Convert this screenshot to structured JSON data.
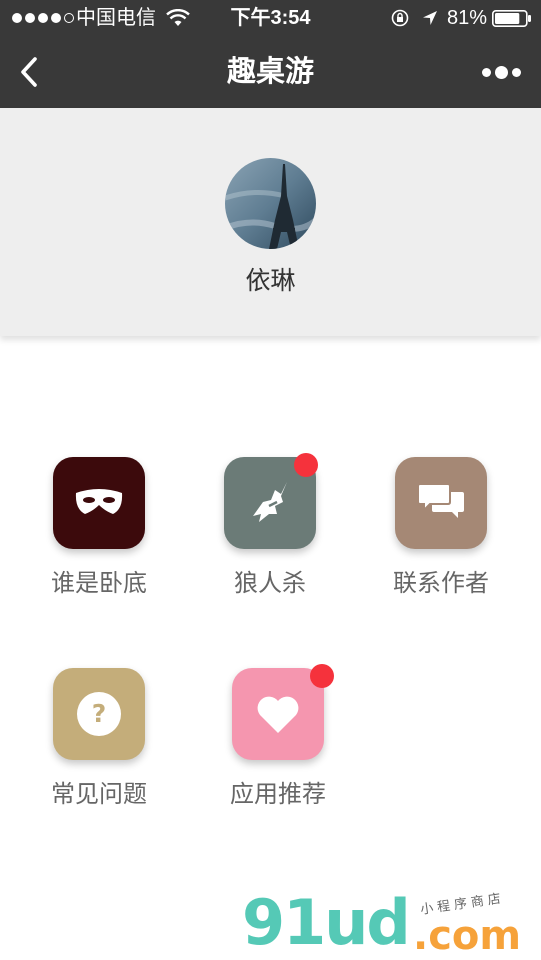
{
  "status_bar": {
    "carrier": "中国电信",
    "time": "下午3:54",
    "battery_pct": "81%",
    "battery_level": 0.81,
    "signal_bars": 4,
    "signal_max": 5
  },
  "nav": {
    "title": "趣桌游"
  },
  "profile": {
    "username": "依琳"
  },
  "grid": [
    {
      "label": "谁是卧底",
      "color": "#3c0a0c",
      "icon": "mask-icon",
      "badge": false
    },
    {
      "label": "狼人杀",
      "color": "#6b7b77",
      "icon": "wolf-icon",
      "badge": true
    },
    {
      "label": "联系作者",
      "color": "#a58875",
      "icon": "chat-bubbles-icon",
      "badge": false
    },
    {
      "label": "常见问题",
      "color": "#c4ad7a",
      "icon": "question-icon",
      "badge": false
    },
    {
      "label": "应用推荐",
      "color": "#f596af",
      "icon": "heart-icon",
      "badge": true
    }
  ],
  "watermark": {
    "logo": "91ud",
    "suffix": ".com",
    "tagline": "小程序商店"
  }
}
